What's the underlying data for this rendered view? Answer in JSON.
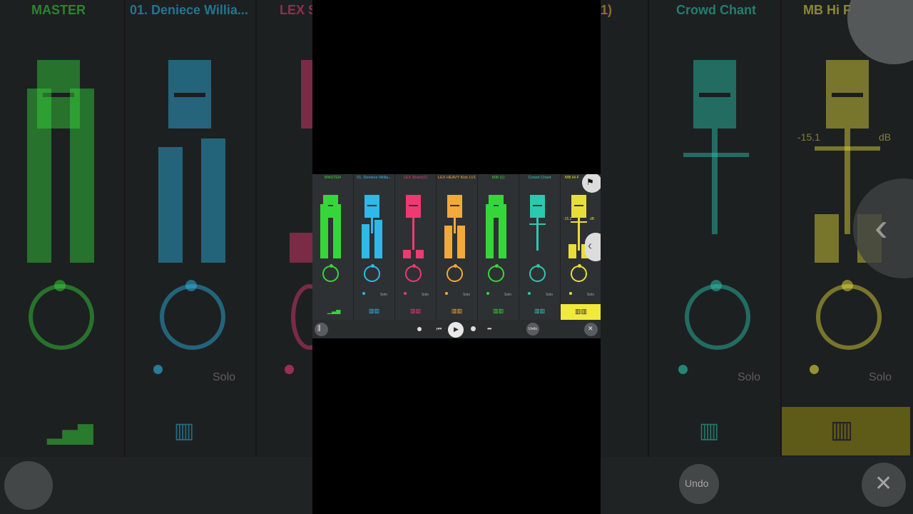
{
  "channels": [
    {
      "name": "MASTER",
      "color": "#36d63a",
      "solo": "",
      "icon": "equalizer-icon"
    },
    {
      "name": "01. Deniece Willia...",
      "color": "#2fb8e8",
      "solo": "Solo",
      "icon": "piano-icon"
    },
    {
      "name": "LEX Snare(1)",
      "color": "#ee3a72",
      "solo": "Solo",
      "icon": "piano-icon"
    },
    {
      "name": "LEX HEAVY Kick LV1",
      "color": "#f2a93a",
      "solo": "Solo",
      "icon": "piano-icon"
    },
    {
      "name": "808 (1)",
      "color": "#36d63a",
      "solo": "Solo",
      "icon": "piano-icon"
    },
    {
      "name": "Crowd Chant",
      "color": "#2bc9b0",
      "solo": "Solo",
      "icon": "piano-icon"
    },
    {
      "name": "MB Hi F",
      "color": "#e8de3a",
      "solo": "Solo",
      "icon": "piano-icon"
    }
  ],
  "fader_db": {
    "value": "-15.1",
    "unit": "dB"
  },
  "toolbar": {
    "undo_label": "Undo"
  },
  "bg": {
    "t0": "MASTER",
    "t1": "01. Deniece Willia...",
    "t2": "LEX S",
    "t5": "Crowd Chant",
    "t6": "MB Hi F",
    "t3": "1)",
    "solo": "Solo",
    "db": "-15.1",
    "dbu": "dB",
    "undo": "Undo"
  }
}
